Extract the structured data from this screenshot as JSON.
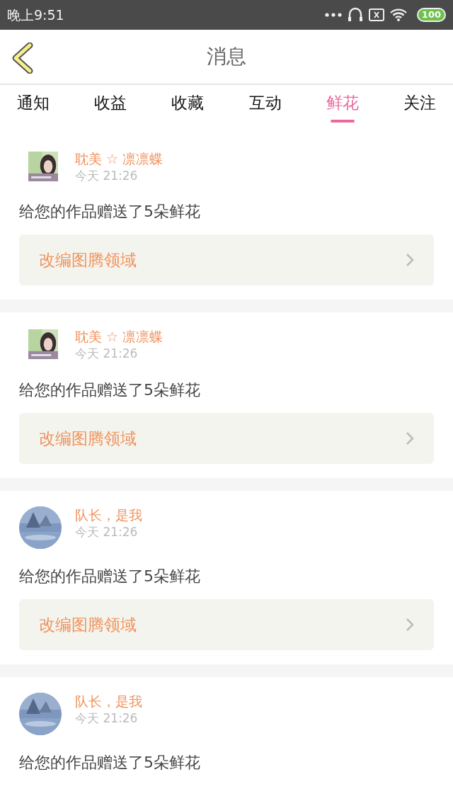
{
  "status_bar": {
    "time": "晚上9:51",
    "battery": "100"
  },
  "header": {
    "title": "消息"
  },
  "tabs": [
    {
      "label": "通知",
      "selected": false
    },
    {
      "label": "收益",
      "selected": false
    },
    {
      "label": "收藏",
      "selected": false
    },
    {
      "label": "互动",
      "selected": false
    },
    {
      "label": "鲜花",
      "selected": true
    },
    {
      "label": "关注",
      "selected": false
    }
  ],
  "messages": [
    {
      "kind": "square",
      "name": "耽美 ☆ 凛凛蝶",
      "time": "今天 21:26",
      "text": "给您的作品赠送了5朵鲜花",
      "work": "改编图腾领域"
    },
    {
      "kind": "square",
      "name": "耽美 ☆ 凛凛蝶",
      "time": "今天 21:26",
      "text": "给您的作品赠送了5朵鲜花",
      "work": "改编图腾领域"
    },
    {
      "kind": "round",
      "name": "队长，是我",
      "time": "今天 21:26",
      "text": "给您的作品赠送了5朵鲜花",
      "work": "改编图腾领域"
    },
    {
      "kind": "round",
      "name": "队长，是我",
      "time": "今天 21:26",
      "text": "给您的作品赠送了5朵鲜花"
    }
  ]
}
